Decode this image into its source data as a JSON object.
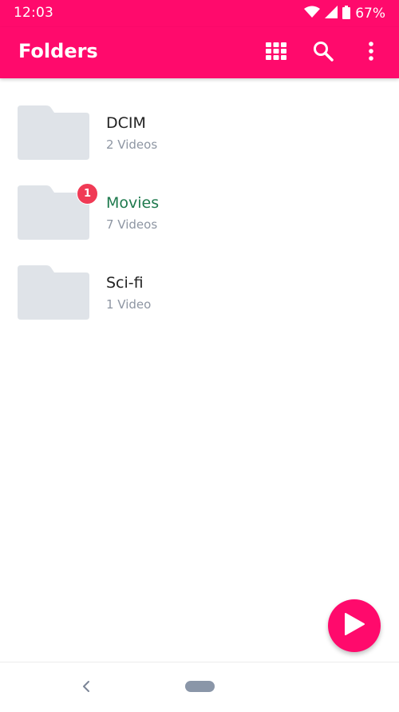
{
  "status_bar": {
    "time": "12:03",
    "battery": "67%",
    "icons": [
      "wifi-icon",
      "signal-icon",
      "battery-icon"
    ]
  },
  "app_bar": {
    "title": "Folders",
    "actions": [
      "grid-view-icon",
      "search-icon",
      "more-vert-icon"
    ]
  },
  "folders": [
    {
      "name": "DCIM",
      "count": "2 Videos",
      "badge": "",
      "highlighted": false
    },
    {
      "name": "Movies",
      "count": "7 Videos",
      "badge": "1",
      "highlighted": true
    },
    {
      "name": "Sci-fi",
      "count": "1 Video",
      "badge": "",
      "highlighted": false
    }
  ],
  "fab": {
    "icon": "play-icon"
  },
  "nav_bar": {
    "icons": [
      "back-icon",
      "home-pill-icon"
    ]
  },
  "colors": {
    "primary": "#ff0a6c",
    "badge": "#f03a55",
    "folder": "#dfe3e8",
    "highlight_text": "#1f7a4e",
    "secondary_text": "#8e96a3"
  }
}
